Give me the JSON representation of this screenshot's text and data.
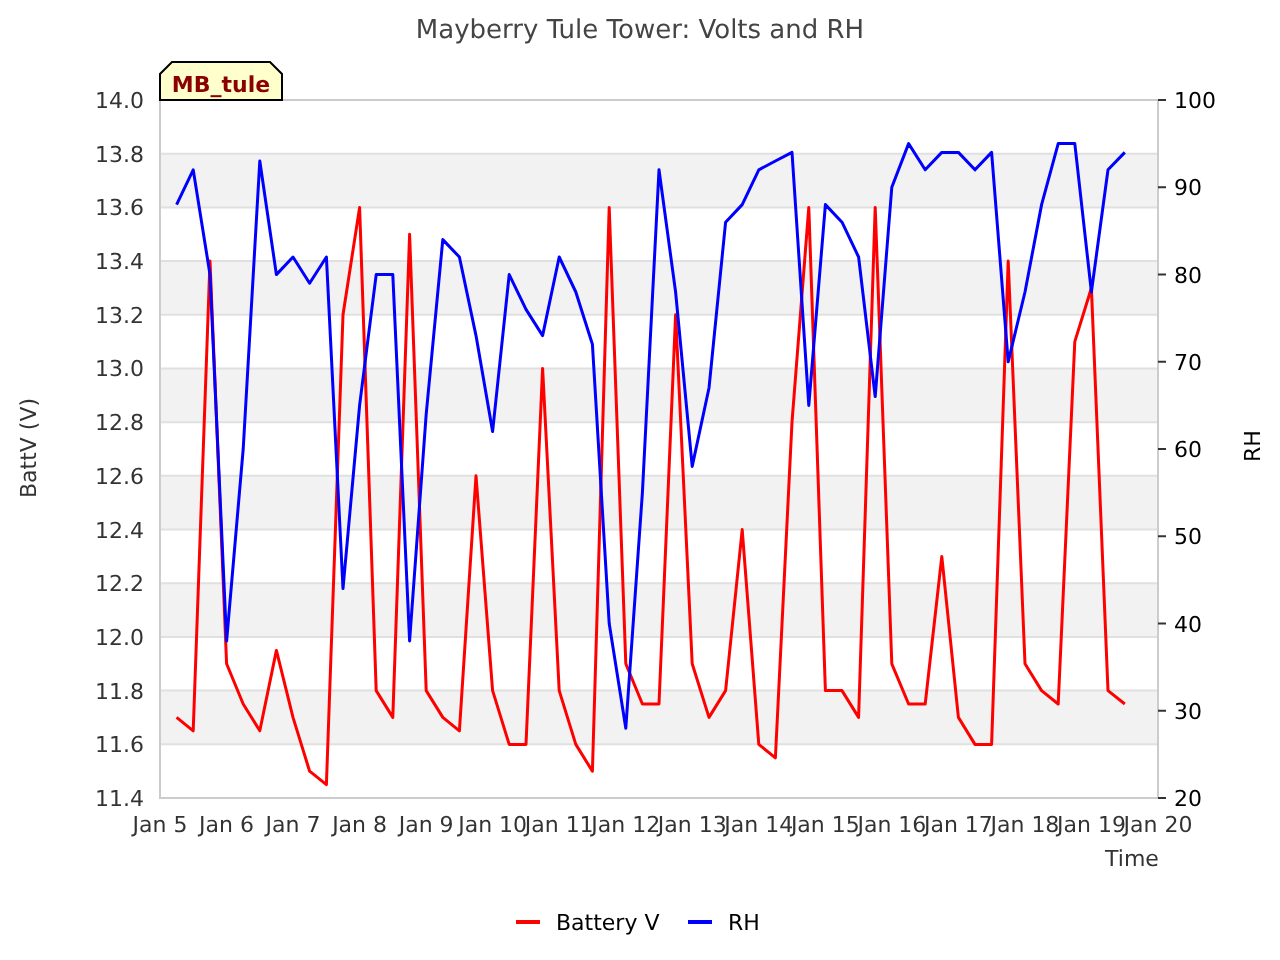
{
  "title": "Mayberry Tule Tower: Volts and RH",
  "station_tag": "MB_tule",
  "chart_data": {
    "type": "line",
    "grid": true,
    "legend": "lower center",
    "xlabel": "Time",
    "ylabel": "BattV (V)",
    "ylim": [
      11.4,
      14.0
    ],
    "yticks": [
      {
        "value": 11.4,
        "label": "11.4"
      },
      {
        "value": 11.6,
        "label": "11.6"
      },
      {
        "value": 11.8,
        "label": "11.8"
      },
      {
        "value": 12.0,
        "label": "12.0"
      },
      {
        "value": 12.2,
        "label": "12.2"
      },
      {
        "value": 12.4,
        "label": "12.4"
      },
      {
        "value": 12.6,
        "label": "12.6"
      },
      {
        "value": 12.8,
        "label": "12.8"
      },
      {
        "value": 13.0,
        "label": "13.0"
      },
      {
        "value": 13.2,
        "label": "13.2"
      },
      {
        "value": 13.4,
        "label": "13.4"
      },
      {
        "value": 13.6,
        "label": "13.6"
      },
      {
        "value": 13.8,
        "label": "13.8"
      },
      {
        "value": 14.0,
        "label": "14.0"
      }
    ],
    "categories": [
      "Jan 5",
      null,
      null,
      null,
      "Jan 6",
      null,
      null,
      null,
      "Jan 7",
      null,
      null,
      null,
      "Jan 8",
      null,
      null,
      null,
      "Jan 9",
      null,
      null,
      null,
      "Jan 10",
      null,
      null,
      null,
      "Jan 11",
      null,
      null,
      null,
      "Jan 12",
      null,
      null,
      null,
      "Jan 13",
      null,
      null,
      null,
      "Jan 14",
      null,
      null,
      null,
      "Jan 15",
      null,
      null,
      null,
      "Jan 16",
      null,
      null,
      null,
      "Jan 17",
      null,
      null,
      null,
      "Jan 18",
      null,
      null,
      null,
      "Jan 19",
      null,
      null,
      null,
      "Jan 20"
    ],
    "series": [
      {
        "name": "Battery V",
        "color": "#ff0000",
        "values": [
          null,
          11.7,
          11.65,
          13.4,
          11.9,
          11.75,
          11.65,
          11.95,
          11.7,
          11.5,
          11.45,
          13.2,
          13.6,
          11.8,
          11.7,
          13.5,
          11.8,
          11.7,
          11.65,
          12.6,
          11.8,
          11.6,
          11.6,
          13.0,
          11.8,
          11.6,
          11.5,
          13.6,
          11.9,
          11.75,
          11.75,
          13.2,
          11.9,
          11.7,
          11.8,
          12.4,
          11.6,
          11.55,
          12.8,
          13.6,
          11.8,
          11.8,
          11.7,
          13.6,
          11.9,
          11.75,
          11.75,
          12.3,
          11.7,
          11.6,
          11.6,
          13.4,
          11.9,
          11.8,
          11.75,
          13.1,
          13.3,
          11.8,
          11.75,
          null,
          null
        ]
      },
      {
        "name": "RH",
        "color": "#0000ff",
        "axis": "y2",
        "values": [
          null,
          88,
          92,
          80,
          38,
          60,
          93,
          80,
          82,
          79,
          82,
          44,
          65,
          80,
          80,
          38,
          64,
          84,
          82,
          73,
          62,
          80,
          76,
          73,
          82,
          78,
          72,
          40,
          28,
          55,
          92,
          78,
          58,
          67,
          86,
          88,
          92,
          93,
          94,
          65,
          88,
          86,
          82,
          66,
          90,
          95,
          92,
          94,
          94,
          92,
          94,
          70,
          78,
          88,
          95,
          95,
          78,
          92,
          94,
          null,
          null
        ]
      }
    ],
    "y2label": "RH",
    "y2lim": [
      20,
      100
    ],
    "y2ticks": [
      20,
      30,
      40,
      50,
      60,
      70,
      80,
      90,
      100
    ]
  }
}
